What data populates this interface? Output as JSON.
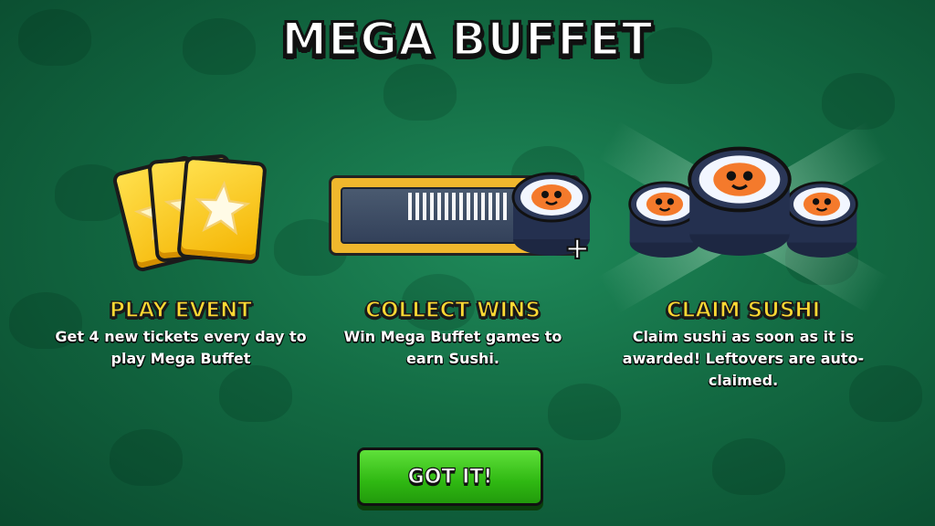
{
  "title": "MEGA BUFFET",
  "steps": [
    {
      "heading": "PLAY EVENT",
      "description": "Get 4 new tickets every day to play Mega Buffet",
      "icon": "ticket-stack-icon"
    },
    {
      "heading": "COLLECT WINS",
      "description": "Win Mega Buffet games to earn Sushi.",
      "icon": "progress-bar-sushi-icon"
    },
    {
      "heading": "CLAIM SUSHI",
      "description": "Claim sushi as soon as it is awarded! Leftovers are auto-claimed.",
      "icon": "sushi-trio-icon"
    }
  ],
  "button": {
    "label": "GOT IT!"
  },
  "colors": {
    "heading": "#ffd933",
    "button": "#2fb812",
    "background": "#136b43"
  }
}
